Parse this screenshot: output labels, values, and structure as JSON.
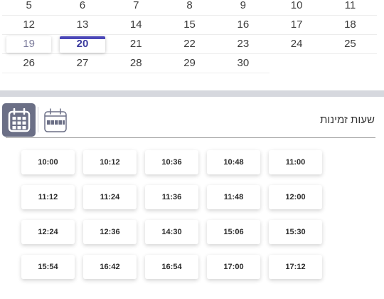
{
  "calendar": {
    "weeks": [
      [
        "5",
        "6",
        "7",
        "8",
        "9",
        "10",
        "11"
      ],
      [
        "12",
        "13",
        "14",
        "15",
        "16",
        "17",
        "18"
      ],
      [
        "19",
        "20",
        "21",
        "22",
        "23",
        "24",
        "25"
      ],
      [
        "26",
        "27",
        "28",
        "29",
        "30",
        "",
        ""
      ]
    ]
  },
  "section": {
    "title": "שעות זמינות"
  },
  "slots": {
    "row1": [
      "10:00",
      "10:12",
      "10:36",
      "10:48",
      "11:00"
    ],
    "row2": [
      "11:12",
      "11:24",
      "11:36",
      "11:48",
      "12:00"
    ],
    "row3": [
      "12:24",
      "12:36",
      "14:30",
      "15:06",
      "15:30"
    ],
    "row4": [
      "15:54",
      "16:42",
      "16:54",
      "17:00",
      "17:12"
    ]
  },
  "colors": {
    "accent": "#4b47b8",
    "toggle_active": "#6b6f86"
  }
}
